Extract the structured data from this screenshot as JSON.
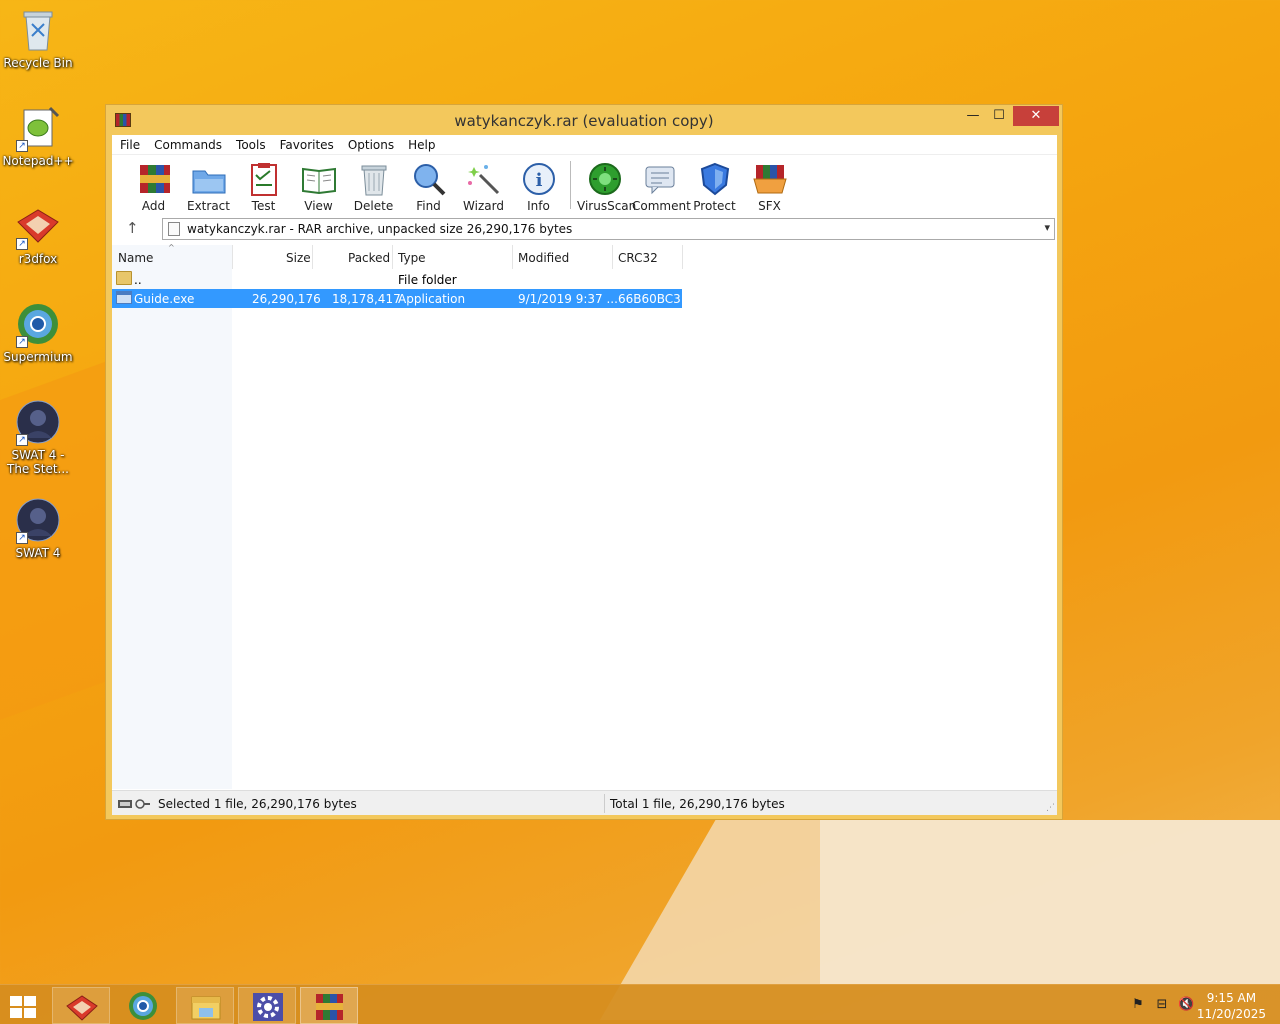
{
  "desktop": {
    "icons": [
      {
        "label": "Recycle Bin"
      },
      {
        "label": "Notepad++"
      },
      {
        "label": "r3dfox"
      },
      {
        "label": "Supermium"
      },
      {
        "label_line1": "SWAT 4 -",
        "label_line2": "The Stet..."
      },
      {
        "label": "SWAT 4"
      }
    ]
  },
  "window": {
    "title": "watykanczyk.rar (evaluation copy)",
    "controls": {
      "minimize": "—",
      "maximize": "☐",
      "close": "✕"
    }
  },
  "menu": [
    "File",
    "Commands",
    "Tools",
    "Favorites",
    "Options",
    "Help"
  ],
  "toolbar": {
    "buttons": [
      {
        "label": "Add",
        "icon": "add-archive-icon"
      },
      {
        "label": "Extract To",
        "icon": "extract-folder-icon"
      },
      {
        "label": "Test",
        "icon": "test-clipboard-icon"
      },
      {
        "label": "View",
        "icon": "view-book-icon"
      },
      {
        "label": "Delete",
        "icon": "trash-icon"
      },
      {
        "label": "Find",
        "icon": "magnifier-icon"
      },
      {
        "label": "Wizard",
        "icon": "magic-wand-icon"
      },
      {
        "label": "Info",
        "icon": "info-icon"
      },
      {
        "label": "VirusScan",
        "icon": "virus-scan-icon"
      },
      {
        "label": "Comment",
        "icon": "comment-icon"
      },
      {
        "label": "Protect",
        "icon": "shield-icon"
      },
      {
        "label": "SFX",
        "icon": "sfx-box-icon"
      }
    ]
  },
  "address": {
    "text": "watykanczyk.rar - RAR archive, unpacked size 26,290,176 bytes"
  },
  "columns": {
    "name": "Name",
    "size": "Size",
    "packed": "Packed",
    "type": "Type",
    "modified": "Modified",
    "crc": "CRC32"
  },
  "files": [
    {
      "name": "..",
      "size": "",
      "packed": "",
      "type": "File folder",
      "modified": "",
      "crc": ""
    },
    {
      "name": "Guide.exe",
      "size": "26,290,176",
      "packed": "18,178,417",
      "type": "Application",
      "modified": "9/1/2019 9:37 ...",
      "crc": "66B60BC3"
    }
  ],
  "status": {
    "left": "Selected 1 file, 26,290,176 bytes",
    "right": "Total 1 file, 26,290,176 bytes"
  },
  "taskbar": {
    "time": "9:15 AM",
    "date": "11/20/2025"
  },
  "colors": {
    "accent_selection": "#3399ff",
    "window_frame": "#f3c85c",
    "close_button": "#c7403a"
  }
}
